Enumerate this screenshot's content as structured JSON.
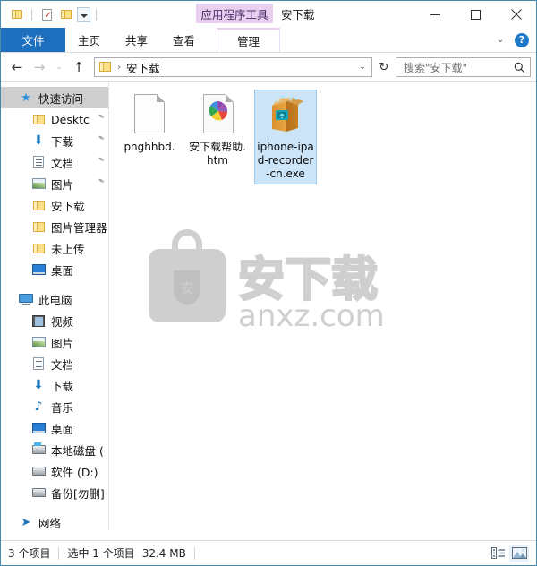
{
  "titlebar": {
    "contextual_tab_title": "应用程序工具",
    "window_title": "安下载",
    "quick_access": [
      {
        "name": "new-folder",
        "icon": "folder-icon"
      },
      {
        "name": "properties",
        "icon": "properties-icon"
      },
      {
        "name": "undo-folder",
        "icon": "folder-icon"
      },
      {
        "name": "customize-dropdown",
        "icon": "chevron-down-icon"
      }
    ],
    "minimize_label": "−",
    "maximize_label": "□",
    "close_label": "✕"
  },
  "ribbon": {
    "tabs": [
      {
        "label": "文件",
        "type": "file"
      },
      {
        "label": "主页",
        "type": "normal"
      },
      {
        "label": "共享",
        "type": "normal"
      },
      {
        "label": "查看",
        "type": "normal"
      },
      {
        "label": "管理",
        "type": "contextual"
      }
    ],
    "collapse_label": "⌄",
    "help_label": "?"
  },
  "address": {
    "back_label": "←",
    "forward_label": "→",
    "recent_label": "⌄",
    "up_label": "↑",
    "breadcrumb_sep": "›",
    "breadcrumb_text": "安下载",
    "dropdown_label": "⌄",
    "refresh_label": "↻",
    "search_placeholder": "搜索\"安下载\"",
    "search_icon_label": "⌕"
  },
  "sidebar": {
    "items": [
      {
        "label": "快速访问",
        "icon": "star-icon",
        "level": 0,
        "selected": true,
        "pinned": false
      },
      {
        "label": "Desktc",
        "icon": "folder-icon",
        "level": 1,
        "selected": false,
        "pinned": true
      },
      {
        "label": "下载",
        "icon": "download-icon",
        "level": 1,
        "selected": false,
        "pinned": true
      },
      {
        "label": "文档",
        "icon": "document-icon",
        "level": 1,
        "selected": false,
        "pinned": true
      },
      {
        "label": "图片",
        "icon": "picture-icon",
        "level": 1,
        "selected": false,
        "pinned": true
      },
      {
        "label": "安下载",
        "icon": "folder-icon",
        "level": 1,
        "selected": false,
        "pinned": false
      },
      {
        "label": "图片管理器",
        "icon": "folder-icon",
        "level": 1,
        "selected": false,
        "pinned": false
      },
      {
        "label": "未上传",
        "icon": "folder-icon",
        "level": 1,
        "selected": false,
        "pinned": false
      },
      {
        "label": "桌面",
        "icon": "desktop-icon",
        "level": 1,
        "selected": false,
        "pinned": false
      },
      {
        "label": "此电脑",
        "icon": "this-pc-icon",
        "level": 0,
        "selected": false,
        "pinned": false,
        "gap_before": true
      },
      {
        "label": "视频",
        "icon": "video-icon",
        "level": 1,
        "selected": false,
        "pinned": false
      },
      {
        "label": "图片",
        "icon": "picture-icon",
        "level": 1,
        "selected": false,
        "pinned": false
      },
      {
        "label": "文档",
        "icon": "document-icon",
        "level": 1,
        "selected": false,
        "pinned": false
      },
      {
        "label": "下载",
        "icon": "download-icon",
        "level": 1,
        "selected": false,
        "pinned": false
      },
      {
        "label": "音乐",
        "icon": "music-icon",
        "level": 1,
        "selected": false,
        "pinned": false
      },
      {
        "label": "桌面",
        "icon": "desktop-icon",
        "level": 1,
        "selected": false,
        "pinned": false
      },
      {
        "label": "本地磁盘 (",
        "icon": "os-drive-icon",
        "level": 1,
        "selected": false,
        "pinned": false
      },
      {
        "label": "软件 (D:)",
        "icon": "drive-icon",
        "level": 1,
        "selected": false,
        "pinned": false
      },
      {
        "label": "备份[勿删]",
        "icon": "drive-icon",
        "level": 1,
        "selected": false,
        "pinned": false
      },
      {
        "label": "网络",
        "icon": "network-icon",
        "level": 0,
        "selected": false,
        "pinned": false,
        "gap_before": true
      }
    ]
  },
  "files": [
    {
      "name": "pnghhbd.",
      "icon": "blank-document-icon",
      "selected": false
    },
    {
      "name": "安下载帮助.htm",
      "icon": "html-document-icon",
      "selected": false
    },
    {
      "name": "iphone-ipad-recorder-cn.exe",
      "icon": "setup-package-icon",
      "selected": true
    }
  ],
  "watermark": {
    "text_cn": "安下载",
    "text_domain": "anxz.com",
    "badge_char": "安",
    "color": "#cfcfcf"
  },
  "statusbar": {
    "item_count": "3 个项目",
    "selection": "选中 1 个项目",
    "selection_size": "32.4 MB",
    "details_view_label": "details-view",
    "large_icons_view_label": "large-icons-view"
  },
  "colors": {
    "accent": "#1e6fbe",
    "contextual_tab": "#e8cff0",
    "selection": "#cce4f7",
    "sidebar_selected": "#cfcfcf"
  }
}
